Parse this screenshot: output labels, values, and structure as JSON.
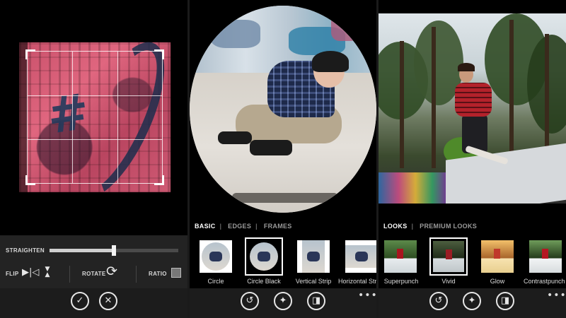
{
  "crop_panel": {
    "straighten_label": "STRAIGHTEN",
    "straighten_value": 0.5,
    "flip_label": "FLIP",
    "rotate_label": "ROTATE",
    "ratio_label": "RATIO",
    "confirm_icon": "✓",
    "cancel_icon": "✕"
  },
  "frames_panel": {
    "tabs": [
      "BASIC",
      "EDGES",
      "FRAMES"
    ],
    "active_tab": "BASIC",
    "thumbnails": [
      "Circle",
      "Circle Black",
      "Vertical Strip",
      "Horizontal Strip"
    ],
    "selected": "Circle Black",
    "undo_icon": "↺",
    "magic_icon": "✦",
    "compare_icon": "◨",
    "more": "•••"
  },
  "looks_panel": {
    "tabs": [
      "LOOKS",
      "PREMIUM LOOKS"
    ],
    "active_tab": "LOOKS",
    "thumbnails": [
      "Superpunch",
      "Vivid",
      "Glow",
      "Contrastpunch"
    ],
    "selected": "Vivid",
    "undo_icon": "↺",
    "magic_icon": "✦",
    "compare_icon": "◨",
    "more": "•••"
  }
}
